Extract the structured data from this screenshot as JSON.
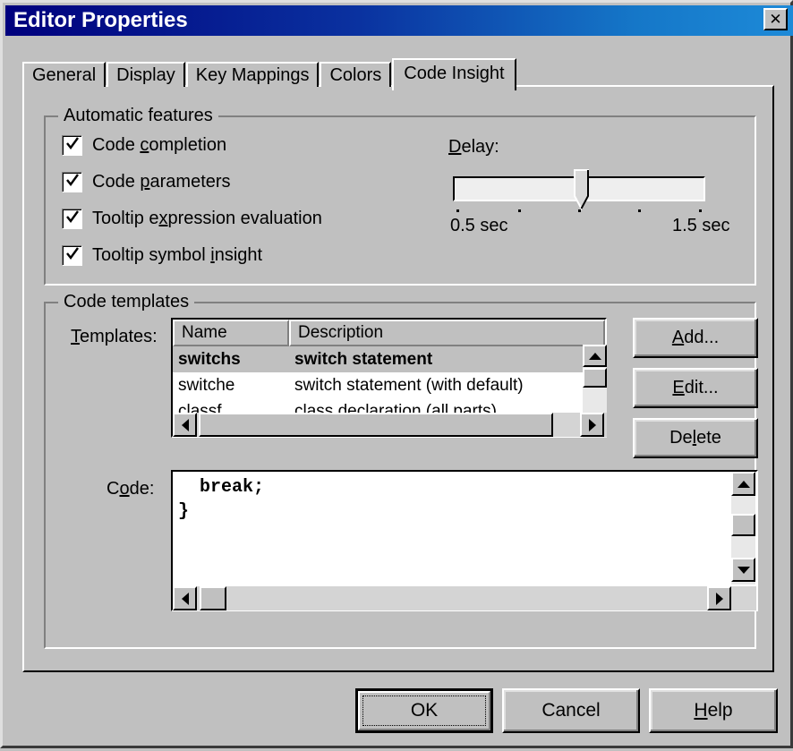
{
  "window": {
    "title": "Editor Properties",
    "close_glyph": "✕",
    "titlebar_color_left": "#00007d",
    "titlebar_color_right": "#1d8ad8",
    "face_color": "#c0c0c0"
  },
  "tabs": [
    {
      "label": "General",
      "active": false
    },
    {
      "label": "Display",
      "active": false
    },
    {
      "label": "Key Mappings",
      "active": false
    },
    {
      "label": "Colors",
      "active": false
    },
    {
      "label": "Code Insight",
      "active": true
    }
  ],
  "automatic_features": {
    "group_title": "Automatic features",
    "checkboxes": [
      {
        "label_pre": "Code ",
        "accel": "c",
        "label_post": "ompletion",
        "checked": true
      },
      {
        "label_pre": "Code ",
        "accel": "p",
        "label_post": "arameters",
        "checked": true
      },
      {
        "label_pre": "Tooltip e",
        "accel": "x",
        "label_post": "pression evaluation",
        "checked": true
      },
      {
        "label_pre": "Tooltip symbol ",
        "accel": "i",
        "label_post": "nsight",
        "checked": true
      }
    ],
    "delay": {
      "label_pre": "",
      "accel": "D",
      "label_post": "elay:",
      "min_label": "0.5 sec",
      "max_label": "1.5 sec",
      "value_position_percent": 50,
      "tick_count": 5
    }
  },
  "code_templates": {
    "group_title": "Code templates",
    "templates_label_pre": "",
    "templates_label_accel": "T",
    "templates_label_post": "emplates:",
    "columns": [
      "Name",
      "Description"
    ],
    "rows": [
      {
        "name": "switchs",
        "description": "switch statement",
        "selected": true
      },
      {
        "name": "switche",
        "description": "switch statement (with default)",
        "selected": false
      },
      {
        "name": "classf",
        "description": "class declaration (all parts)",
        "selected": false
      }
    ],
    "buttons": [
      {
        "accel": "A",
        "label_post": "dd...",
        "label_pre": ""
      },
      {
        "accel": "E",
        "label_post": "dit...",
        "label_pre": ""
      },
      {
        "accel": "l",
        "label_post": "ete",
        "label_pre": "De"
      }
    ],
    "code_label_pre": "C",
    "code_label_accel": "o",
    "code_label_post": "de:",
    "code_text": "  break;\n}"
  },
  "footer": {
    "ok": "OK",
    "cancel": "Cancel",
    "help_pre": "",
    "help_accel": "H",
    "help_post": "elp"
  }
}
